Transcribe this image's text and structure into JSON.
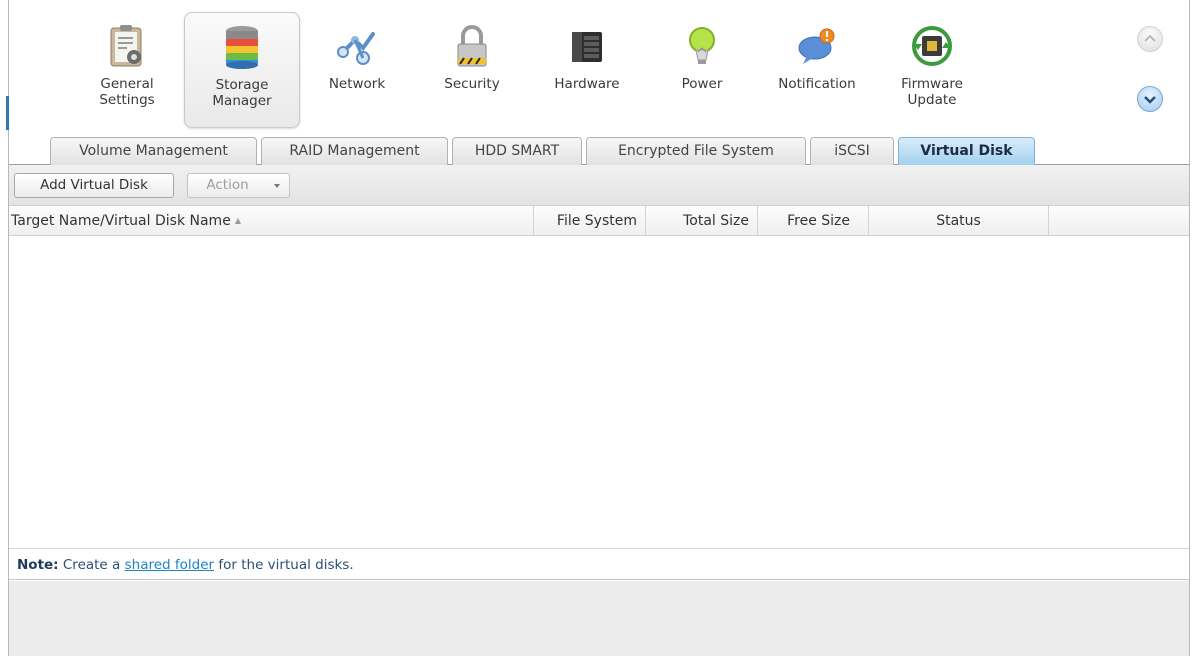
{
  "toolbar": {
    "items": [
      {
        "label": "General\nSettings",
        "icon": "general-settings-icon",
        "active": false
      },
      {
        "label": "Storage\nManager",
        "icon": "storage-manager-icon",
        "active": true
      },
      {
        "label": "Network",
        "icon": "network-icon",
        "active": false
      },
      {
        "label": "Security",
        "icon": "lock-icon",
        "active": false
      },
      {
        "label": "Hardware",
        "icon": "hardware-icon",
        "active": false
      },
      {
        "label": "Power",
        "icon": "lightbulb-icon",
        "active": false
      },
      {
        "label": "Notification",
        "icon": "notification-bubble-icon",
        "active": false
      },
      {
        "label": "Firmware\nUpdate",
        "icon": "firmware-chip-icon",
        "active": false
      }
    ]
  },
  "tabs": [
    {
      "label": "Volume Management",
      "active": false
    },
    {
      "label": "RAID Management",
      "active": false
    },
    {
      "label": "HDD SMART",
      "active": false
    },
    {
      "label": "Encrypted File System",
      "active": false
    },
    {
      "label": "iSCSI",
      "active": false
    },
    {
      "label": "Virtual Disk",
      "active": true
    }
  ],
  "actions": {
    "add_label": "Add Virtual Disk",
    "action_label": "Action"
  },
  "table": {
    "columns": [
      "Target Name/Virtual Disk Name",
      "File System",
      "Total Size",
      "Free Size",
      "Status"
    ],
    "sort_indicator": "▲",
    "rows": []
  },
  "note": {
    "prefix": "Note:",
    "text_before": " Create a ",
    "link": "shared folder",
    "text_after": " for the virtual disks."
  },
  "colors": {
    "active_tab": "#9fcfee",
    "link": "#1a84c9",
    "accent": "#2d7ab7"
  }
}
